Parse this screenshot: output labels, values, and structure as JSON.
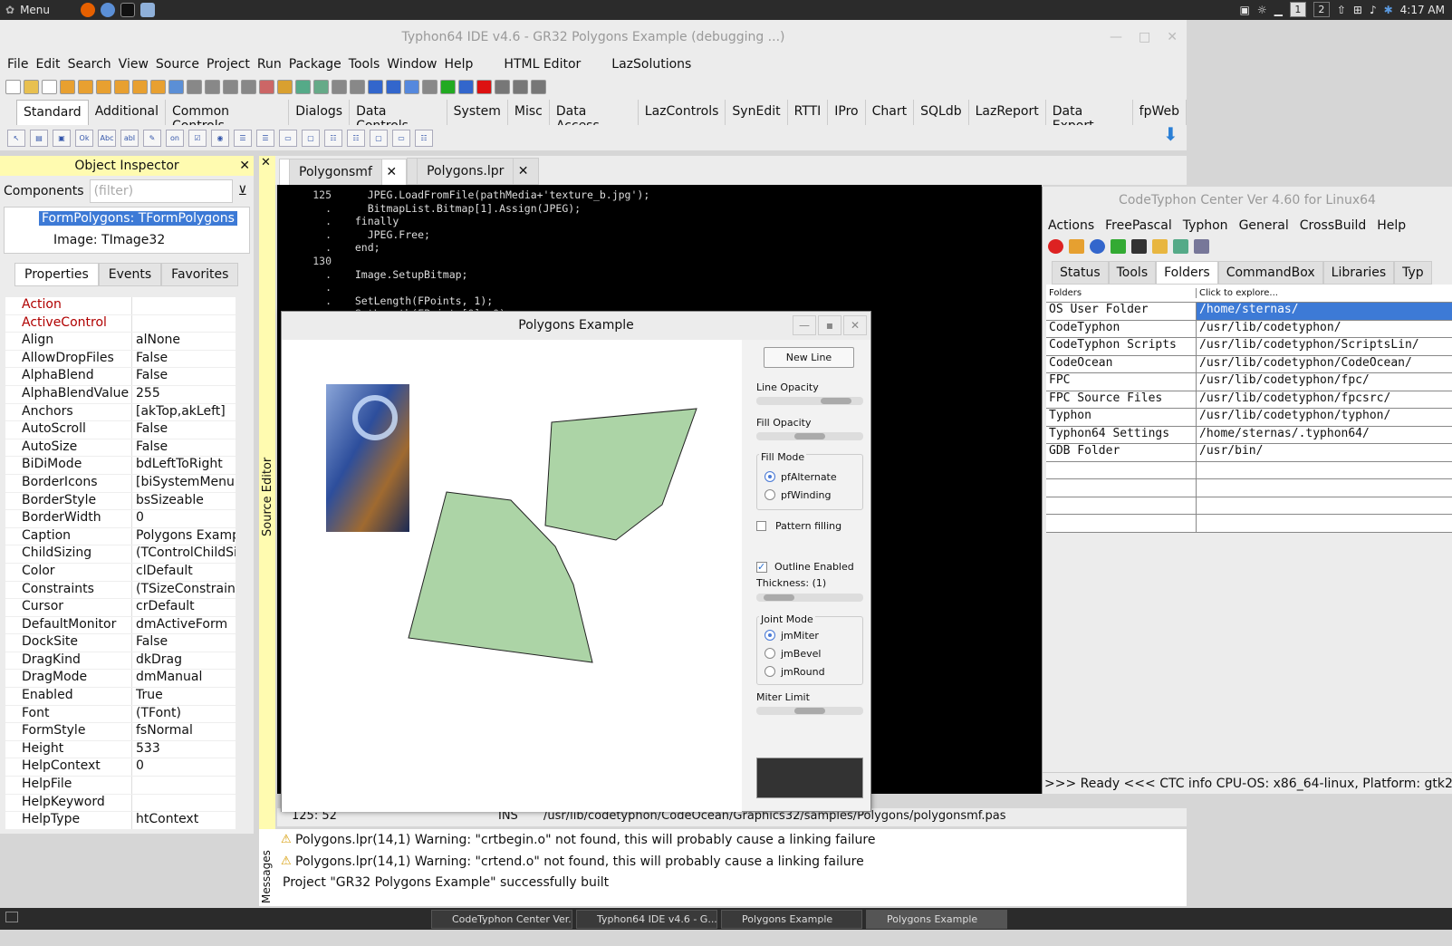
{
  "panel": {
    "menu_label": "Menu",
    "workspaces": [
      "1",
      "2"
    ],
    "clock": "4:17 AM"
  },
  "ide": {
    "title": "Typhon64 IDE v4.6 - GR32 Polygons Example (debugging ...)",
    "menu": [
      "File",
      "Edit",
      "Search",
      "View",
      "Source",
      "Project",
      "Run",
      "Package",
      "Tools",
      "Window",
      "Help",
      "HTML Editor",
      "LazSolutions"
    ],
    "palette_tabs": [
      "Standard",
      "Additional",
      "Common Controls",
      "Dialogs",
      "Data Controls",
      "System",
      "Misc",
      "Data Access",
      "LazControls",
      "SynEdit",
      "RTTI",
      "IPro",
      "Chart",
      "SQLdb",
      "LazReport",
      "Data Export",
      "fpWeb"
    ]
  },
  "inspector": {
    "title": "Object Inspector",
    "components_label": "Components",
    "filter_placeholder": "(filter)",
    "tree": [
      "FormPolygons: TFormPolygons",
      "Image: TImage32"
    ],
    "tabs": [
      "Properties",
      "Events",
      "Favorites"
    ],
    "props": [
      {
        "k": "Action",
        "v": "",
        "red": true
      },
      {
        "k": "ActiveControl",
        "v": "",
        "red": true
      },
      {
        "k": "Align",
        "v": "alNone"
      },
      {
        "k": "AllowDropFiles",
        "v": "False"
      },
      {
        "k": "AlphaBlend",
        "v": "False"
      },
      {
        "k": "AlphaBlendValue",
        "v": "255"
      },
      {
        "k": "Anchors",
        "v": "[akTop,akLeft]"
      },
      {
        "k": "AutoScroll",
        "v": "False"
      },
      {
        "k": "AutoSize",
        "v": "False"
      },
      {
        "k": "BiDiMode",
        "v": "bdLeftToRight"
      },
      {
        "k": "BorderIcons",
        "v": "[biSystemMenu,b"
      },
      {
        "k": "BorderStyle",
        "v": "bsSizeable"
      },
      {
        "k": "BorderWidth",
        "v": "0"
      },
      {
        "k": "Caption",
        "v": "Polygons Example"
      },
      {
        "k": "ChildSizing",
        "v": "(TControlChildSiz"
      },
      {
        "k": "Color",
        "v": "clDefault"
      },
      {
        "k": "Constraints",
        "v": "(TSizeConstraints"
      },
      {
        "k": "Cursor",
        "v": "crDefault"
      },
      {
        "k": "DefaultMonitor",
        "v": "dmActiveForm"
      },
      {
        "k": "DockSite",
        "v": "False"
      },
      {
        "k": "DragKind",
        "v": "dkDrag"
      },
      {
        "k": "DragMode",
        "v": "dmManual"
      },
      {
        "k": "Enabled",
        "v": "True"
      },
      {
        "k": "Font",
        "v": "(TFont)"
      },
      {
        "k": "FormStyle",
        "v": "fsNormal"
      },
      {
        "k": "Height",
        "v": "533"
      },
      {
        "k": "HelpContext",
        "v": "0"
      },
      {
        "k": "HelpFile",
        "v": ""
      },
      {
        "k": "HelpKeyword",
        "v": ""
      },
      {
        "k": "HelpType",
        "v": "htContext"
      }
    ]
  },
  "editor": {
    "vertical_label": "Source Editor",
    "tabs": [
      "Polygonsmf",
      "Polygons.lpr"
    ],
    "lines": [
      {
        "n": "125",
        "c": "    JPEG.LoadFromFile(pathMedia+'texture_b.jpg');"
      },
      {
        "n": ".",
        "c": "    BitmapList.Bitmap[1].Assign(JPEG);"
      },
      {
        "n": ".",
        "c": "  finally"
      },
      {
        "n": ".",
        "c": "    JPEG.Free;"
      },
      {
        "n": ".",
        "c": "  end;"
      },
      {
        "n": "130",
        "c": ""
      },
      {
        "n": ".",
        "c": "  Image.SetupBitmap;"
      },
      {
        "n": ".",
        "c": ""
      },
      {
        "n": ".",
        "c": "  SetLength(FPoints, 1);"
      },
      {
        "n": ".",
        "c": "  SetLength(FPoints[0], 0);"
      }
    ],
    "status_pos": "125: 52",
    "status_mode": "INS",
    "status_file": "/usr/lib/codetyphon/CodeOcean/Graphics32/samples/Polygons/polygonsmf.pas"
  },
  "messages": {
    "vertical_label": "Messages",
    "lines": [
      "Polygons.lpr(14,1) Warning: \"crtbegin.o\" not found, this will probably cause a linking failure",
      "Polygons.lpr(14,1) Warning: \"crtend.o\" not found, this will probably cause a linking failure",
      "Project \"GR32 Polygons Example\" successfully built"
    ]
  },
  "center": {
    "title": "CodeTyphon Center Ver 4.60 for Linux64",
    "menu": [
      "Actions",
      "FreePascal",
      "Typhon",
      "General",
      "CrossBuild",
      "Help"
    ],
    "tabs": [
      "Status",
      "Tools",
      "Folders",
      "CommandBox",
      "Libraries",
      "Typ"
    ],
    "header": [
      "Folders",
      "Click to explore..."
    ],
    "rows": [
      [
        "OS User Folder",
        "/home/sternas/"
      ],
      [
        "CodeTyphon",
        "/usr/lib/codetyphon/"
      ],
      [
        "CodeTyphon Scripts",
        "/usr/lib/codetyphon/ScriptsLin/"
      ],
      [
        "CodeOcean",
        "/usr/lib/codetyphon/CodeOcean/"
      ],
      [
        "FPC",
        "/usr/lib/codetyphon/fpc/"
      ],
      [
        "FPC Source Files",
        "/usr/lib/codetyphon/fpcsrc/"
      ],
      [
        "Typhon",
        "/usr/lib/codetyphon/typhon/"
      ],
      [
        "Typhon64 Settings",
        "/home/sternas/.typhon64/"
      ],
      [
        "GDB Folder",
        "/usr/bin/"
      ]
    ],
    "status": ">>> Ready <<<  CTC info CPU-OS: x86_64-linux, Platform: gtk2"
  },
  "polygons": {
    "title": "Polygons Example",
    "new_line": "New Line",
    "line_opacity": "Line Opacity",
    "fill_opacity": "Fill Opacity",
    "fill_mode": "Fill Mode",
    "fill_opts": [
      "pfAlternate",
      "pfWinding"
    ],
    "pattern": "Pattern filling",
    "outline": "Outline Enabled",
    "thickness": "Thickness: (1)",
    "joint_mode": "Joint Mode",
    "joint_opts": [
      "jmMiter",
      "jmBevel",
      "jmRound"
    ],
    "miter": "Miter Limit",
    "line_opacity_value": 0.85,
    "fill_opacity_value": 0.5,
    "thickness_value": 0.1,
    "miter_value": 0.5,
    "fill_color": "#acd4a6"
  },
  "taskbar": [
    "CodeTyphon Center Ver...",
    "Typhon64 IDE v4.6 - G...",
    "Polygons Example",
    "Polygons Example"
  ]
}
